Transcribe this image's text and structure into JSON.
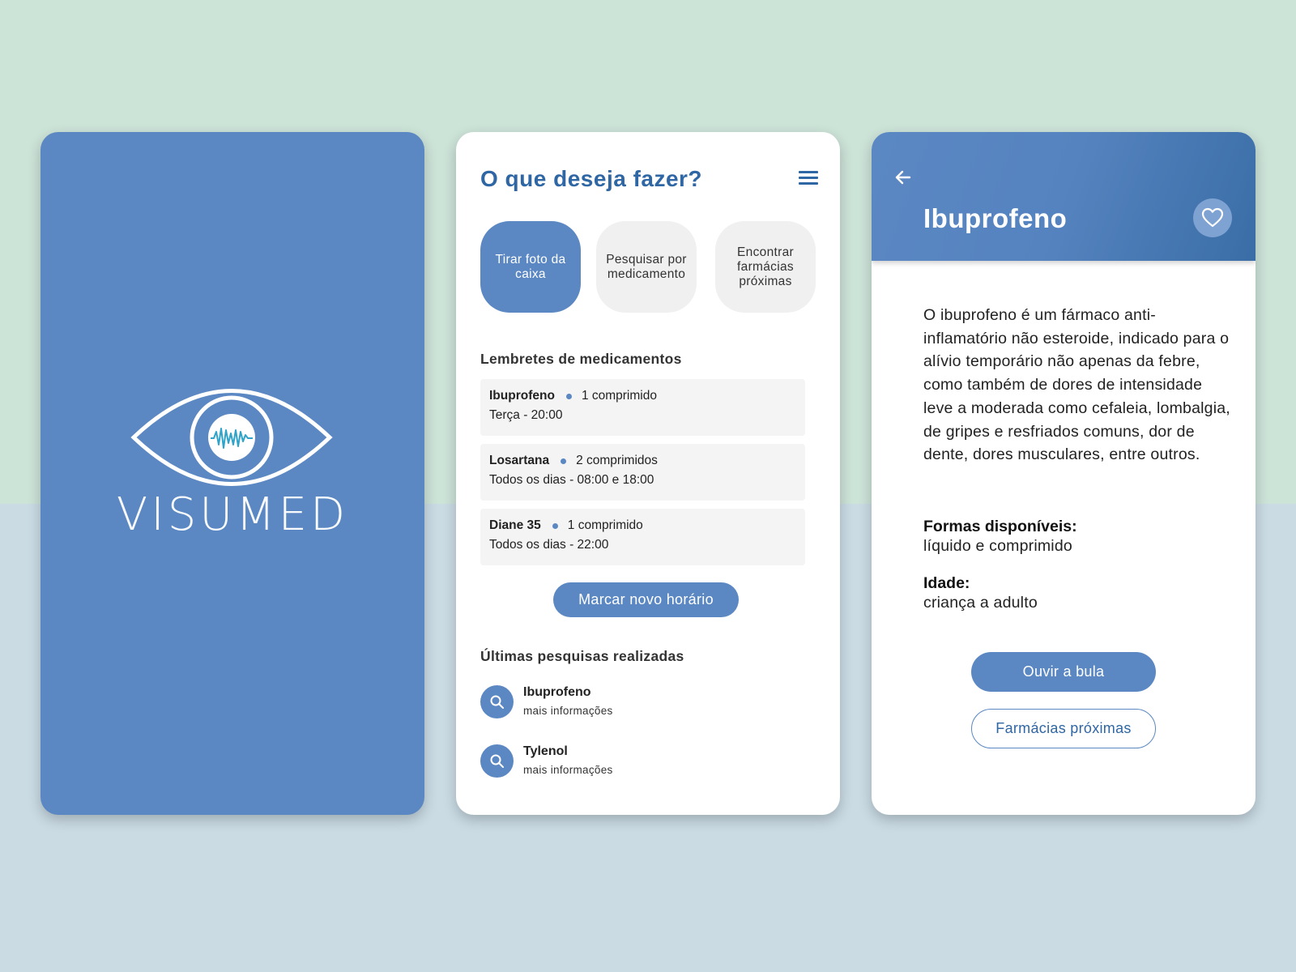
{
  "colors": {
    "brand_blue": "#5b88c3",
    "title_blue": "#2f66a4",
    "background_top": "#cce3d8",
    "background_bottom": "#cadbe4",
    "accent_wave": "#2fa3c9"
  },
  "splash": {
    "logo_text": "VISUMED",
    "logo_icon": "eye-soundwave-logo"
  },
  "home": {
    "title": "O que deseja fazer?",
    "menu_icon": "hamburger-menu-icon",
    "actions": [
      {
        "label": "Tirar foto da caixa"
      },
      {
        "label": "Pesquisar por medicamento"
      },
      {
        "label": "Encontrar farmácias próximas"
      }
    ],
    "reminders_title": "Lembretes de medicamentos",
    "reminders": [
      {
        "name": "Ibuprofeno",
        "dose": "1 comprimido",
        "schedule": "Terça - 20:00"
      },
      {
        "name": "Losartana",
        "dose": "2 comprimidos",
        "schedule": "Todos os dias - 08:00 e 18:00"
      },
      {
        "name": "Diane 35",
        "dose": "1 comprimido",
        "schedule": "Todos os dias - 22:00"
      }
    ],
    "schedule_button": "Marcar novo horário",
    "recent_title": "Últimas pesquisas realizadas",
    "recent": [
      {
        "name": "Ibuprofeno",
        "sub": "mais informações",
        "icon": "search-icon"
      },
      {
        "name": "Tylenol",
        "sub": "mais informações",
        "icon": "search-icon"
      }
    ]
  },
  "detail": {
    "back_icon": "arrow-left-icon",
    "title": "Ibuprofeno",
    "favorite_icon": "heart-icon",
    "description": "O ibuprofeno é um fármaco anti-inflamatório não esteroide, indicado para o alívio temporário não apenas da febre, como também de dores de intensidade leve a moderada como cefaleia, lombalgia, de gripes e resfriados comuns, dor de dente, dores musculares, entre outros.",
    "forms_label": "Formas disponíveis:",
    "forms_value": "líquido e comprimido",
    "age_label": "Idade:",
    "age_value": "criança a adulto",
    "listen_button": "Ouvir a bula",
    "pharmacies_button": "Farmácias próximas"
  }
}
